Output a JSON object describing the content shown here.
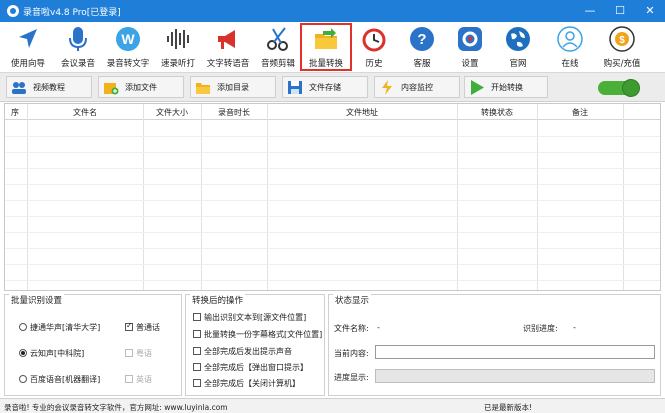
{
  "window": {
    "title": "录音啦v4.8 Pro[已登录]",
    "minimize": "—",
    "maximize": "☐",
    "close": "✕"
  },
  "toolbar": [
    {
      "label": "使用向导",
      "icon": "guide-icon"
    },
    {
      "label": "会议录音",
      "icon": "microphone-icon"
    },
    {
      "label": "录音转文字",
      "icon": "word-icon"
    },
    {
      "label": "速录听打",
      "icon": "waveform-icon"
    },
    {
      "label": "文字转语音",
      "icon": "megaphone-icon"
    },
    {
      "label": "音频剪辑",
      "icon": "scissors-icon"
    },
    {
      "label": "批量转换",
      "icon": "folder-icon",
      "active": true
    },
    {
      "label": "历史",
      "icon": "history-icon"
    },
    {
      "label": "客服",
      "icon": "help-icon"
    },
    {
      "label": "设置",
      "icon": "settings-icon"
    },
    {
      "label": "官网",
      "icon": "globe-icon"
    },
    {
      "label": "在线",
      "icon": "user-icon"
    },
    {
      "label": "购买/充值",
      "icon": "coin-icon"
    }
  ],
  "actions": {
    "video_tutorial": "视频教程",
    "add_file": "添加文件",
    "add_folder": "添加目录",
    "file_save": "文件存储",
    "content_monitor": "内容监控",
    "start_convert": "开始转换"
  },
  "table": {
    "columns": [
      "序",
      "文件名",
      "文件大小",
      "录音时长",
      "文件地址",
      "转换状态",
      "备注"
    ],
    "rows": []
  },
  "batch_settings": {
    "title": "批量识别设置",
    "engine_1": "捷通华声[清华大学]",
    "engine_2": "云知声[中科院]",
    "engine_3": "百度语音[机器翻译]",
    "lang_1": "普通话",
    "lang_2": "粤语",
    "lang_3": "英语"
  },
  "after_convert": {
    "title": "转换后的操作",
    "opt_1": "输出识别文本到[源文件位置]",
    "opt_2": "批量转换一份字幕格式[文件位置]",
    "opt_3": "全部完成后发出提示声音",
    "opt_4": "全部完成后【弹出窗口提示】",
    "opt_5": "全部完成后【关闭计算机】"
  },
  "status": {
    "title": "状态显示",
    "file_name_label": "文件名称:",
    "file_name_value": "-",
    "progress_label": "识别进度:",
    "progress_value": "-",
    "current_content_label": "当前内容:",
    "progress_display_label": "进度显示:"
  },
  "statusbar": {
    "left": "录音啦! 专业的会议录音转文字软件，官方网址: www.luyinla.com",
    "right": "已是最新版本!"
  }
}
